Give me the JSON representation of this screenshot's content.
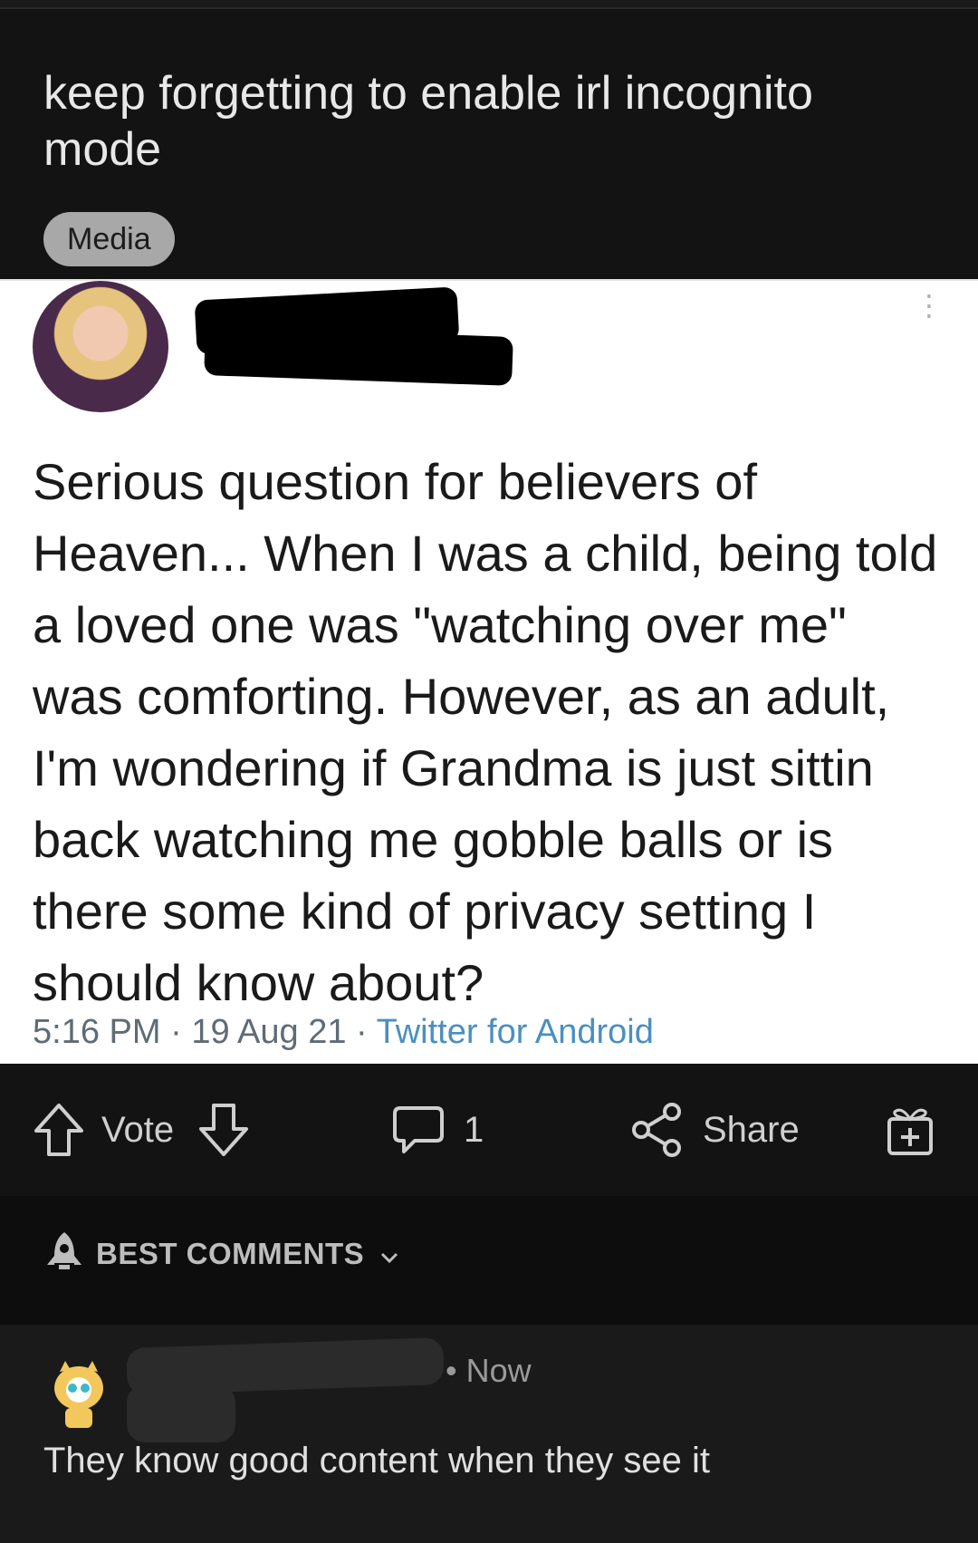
{
  "post": {
    "title": "keep forgetting to enable irl incognito mode",
    "flair": "Media"
  },
  "tweet": {
    "text": "Serious question for believers of Heaven... When I was a child, being told a loved one was \"watching over me\" was comforting. However, as an adult, I'm wondering if Grandma is just sittin back watching me gobble balls or is there some kind of privacy setting I should know about?",
    "time": "5:16 PM",
    "date": "19 Aug 21",
    "source": "Twitter for Android",
    "separator": "·"
  },
  "actions": {
    "vote_label": "Vote",
    "comment_count": "1",
    "share_label": "Share"
  },
  "comments": {
    "sort_label": "BEST COMMENTS",
    "items": [
      {
        "time": "• Now",
        "body": "They know good content when they see it"
      }
    ]
  },
  "colors": {
    "background": "#131313",
    "flair_bg": "#a8a8a8",
    "tweet_source": "#4a8fbf"
  }
}
